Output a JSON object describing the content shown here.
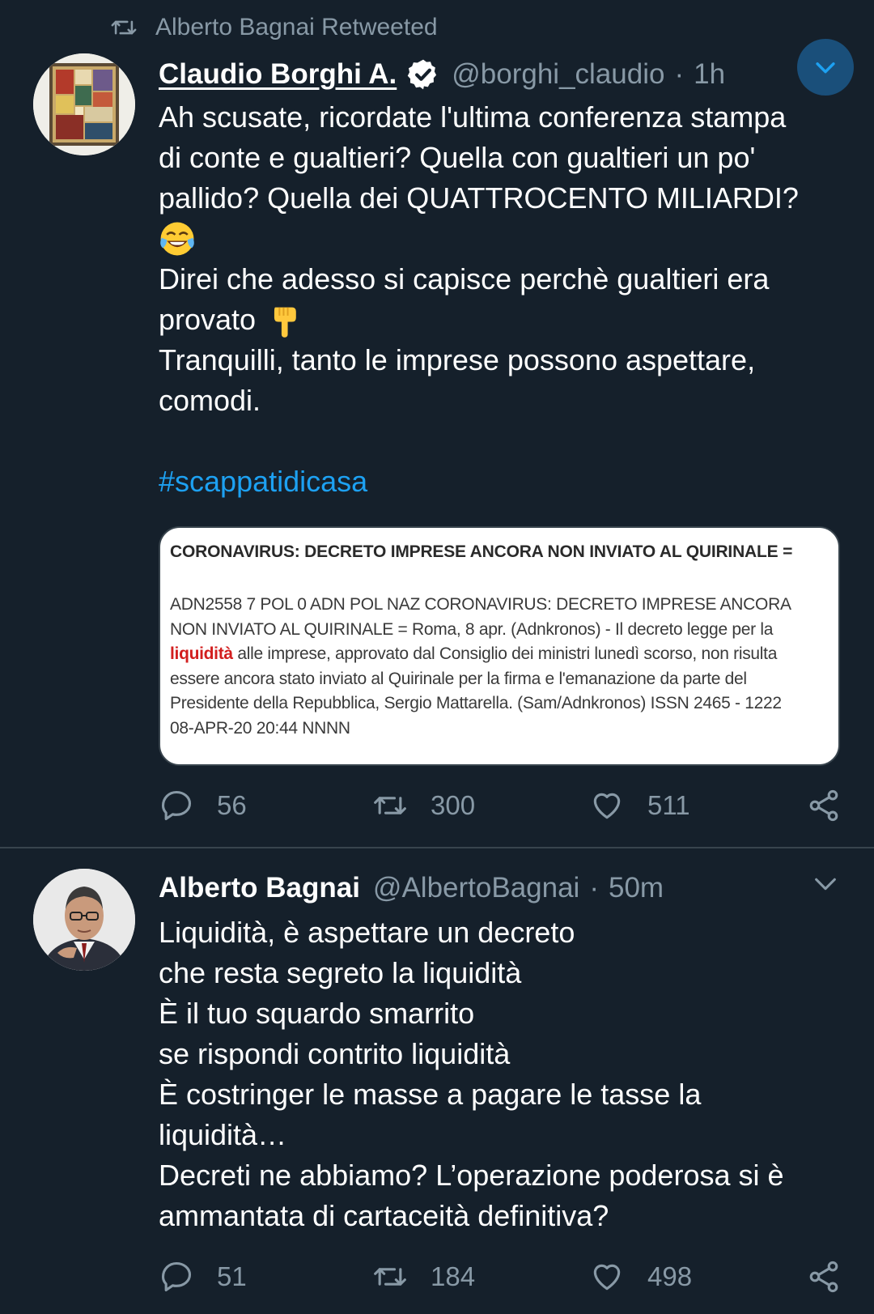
{
  "retweet_header": {
    "text": "Alberto Bagnai Retweeted",
    "icon": "retweet-icon"
  },
  "tweet1": {
    "name": "Claudio Borghi A.",
    "verified": true,
    "handle": "@borghi_claudio",
    "separator": "·",
    "time": "1h",
    "lines": [
      "Ah scusate, ricordate l'ultima conferenza stampa",
      "di conte e gualtieri? Quella con gualtieri un po'",
      "pallido? Quella dei QUATTROCENTO MILIARDI?",
      "Direi che adesso si capisce perchè gualtieri era",
      "provato",
      "Tranquilli, tanto le imprese possono aspettare,",
      "comodi."
    ],
    "emojis": [
      "face-with-tears-of-joy-emoji",
      "backhand-index-pointing-down-emoji"
    ],
    "hashtag": "#scappatidicasa",
    "card": {
      "title": "CORONAVIRUS: DECRETO IMPRESE ANCORA NON INVIATO AL QUIRINALE =",
      "body_line1": "ADN2558 7 POL 0 ADN POL NAZ CORONAVIRUS: DECRETO IMPRESE ANCORA",
      "body_line2": "NON INVIATO AL QUIRINALE = Roma, 8 apr. (Adnkronos) - Il decreto legge per la",
      "body_line3_highlight": "liquidità",
      "body_line3_rest": " alle imprese, approvato dal Consiglio dei ministri lunedì scorso, non risulta",
      "body_line4": "essere ancora stato inviato al Quirinale per la firma e l'emanazione da parte del",
      "body_line5": "Presidente della Repubblica, Sergio Mattarella. (Sam/Adnkronos) ISSN 2465 - 1222",
      "body_line6": "08-APR-20 20:44 NNNN"
    },
    "stats": {
      "replies": "56",
      "retweets": "300",
      "likes": "511"
    }
  },
  "tweet2": {
    "name": "Alberto Bagnai",
    "handle": "@AlbertoBagnai",
    "separator": "·",
    "time": "50m",
    "lines": [
      "Liquidità, è aspettare un decreto",
      "che resta segreto la liquidità",
      "È il tuo squardo smarrito",
      "se rispondi contrito liquidità",
      "È costringer le masse a pagare le tasse la",
      "liquidità…",
      "Decreti ne abbiamo? L’operazione poderosa si è",
      "ammantata di cartaceità definitiva?"
    ],
    "stats": {
      "replies": "51",
      "retweets": "184",
      "likes": "498"
    }
  },
  "colors": {
    "background": "#15202b",
    "secondary_text": "#8899a6",
    "accent": "#1da1f2",
    "divider": "#38444d"
  }
}
